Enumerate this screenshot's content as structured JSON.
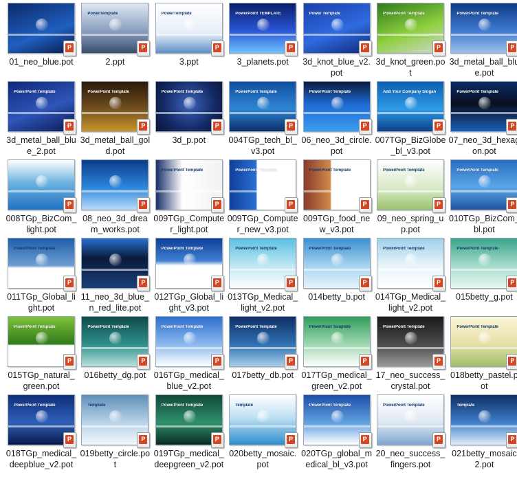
{
  "files": [
    {
      "name": "01_neo_blue.pot",
      "thumb": {
        "bg": "linear-gradient(160deg,#0b2a6b,#1f5fbf 60%,#0a1a4a)",
        "title": "",
        "dark": false
      }
    },
    {
      "name": "2.ppt",
      "thumb": {
        "bg": "linear-gradient(180deg,#dfe7f2,#8aa0bf 55%,#3c4f6d)",
        "title": "PowerTemplate",
        "dark": true
      }
    },
    {
      "name": "3.ppt",
      "thumb": {
        "bg": "linear-gradient(180deg,#ffffff,#e6eef7 60%,#5f8fc8)",
        "title": "PowerTemplate",
        "dark": true
      }
    },
    {
      "name": "3_planets.pot",
      "thumb": {
        "bg": "linear-gradient(180deg,#0a1d6a,#2a56d6 55%,#71c2ff)",
        "title": "PowerPoint TEMPLATE",
        "dark": false
      }
    },
    {
      "name": "3d_knot_blue_v2.pot",
      "thumb": {
        "bg": "linear-gradient(160deg,#1a3ea8,#2f6be0 55%,#0f2a7a)",
        "title": "Power Template",
        "dark": false
      }
    },
    {
      "name": "3d_knot_green.pot",
      "thumb": {
        "bg": "linear-gradient(160deg,#2f7a1c,#8ecf3e 55%,#cfd8cf)",
        "title": "PowerPoint Template",
        "dark": false
      }
    },
    {
      "name": "3d_metal_ball_blue.pot",
      "thumb": {
        "bg": "linear-gradient(180deg,#0f3b86,#3f7ad0 55%,#9dbfe8)",
        "title": "PowerPoint Template",
        "dark": false
      }
    },
    {
      "name": "3d_metal_ball_blue_2.pot",
      "thumb": {
        "bg": "linear-gradient(160deg,#10287a,#2e55b8 55%,#0b1b55)",
        "title": "PowerPoint Template",
        "dark": false
      }
    },
    {
      "name": "3d_metal_ball_gold.pot",
      "thumb": {
        "bg": "linear-gradient(180deg,#2b1a08,#6b4a1f 50%,#c8952a)",
        "title": "PowerPoint Template",
        "dark": false
      }
    },
    {
      "name": "3d_p.pot",
      "thumb": {
        "bg": "radial-gradient(circle at 50% 45%,#3b64b8,#142a66 60%,#0a1433)",
        "title": "PowerPoint Template",
        "dark": false
      }
    },
    {
      "name": "004TGp_tech_bl_v3.pot",
      "thumb": {
        "bg": "linear-gradient(180deg,#0f4fa0,#2e86d4 55%,#0b2d66)",
        "title": "PowerPoint Template",
        "dark": false
      }
    },
    {
      "name": "06_neo_3d_circle.pot",
      "thumb": {
        "bg": "linear-gradient(180deg,#0a1c3e,#1e6bd2 45%,#3a9cf0)",
        "title": "PowerPoint Template",
        "dark": false
      }
    },
    {
      "name": "007TGp_BizGlobe_bl_v3.pot",
      "thumb": {
        "bg": "linear-gradient(180deg,#0b5fb0,#2f9ae6 55%,#0a3f86)",
        "title": "Add Your Company Slogan",
        "dark": false
      }
    },
    {
      "name": "07_neo_3d_hexagon.pot",
      "thumb": {
        "bg": "linear-gradient(180deg,#0a2c66,#0a0f22 45%,#1b5fb8)",
        "title": "PowerPoint Template",
        "dark": false
      }
    },
    {
      "name": "008TGp_BizCom_light.pot",
      "thumb": {
        "bg": "linear-gradient(180deg,#ffffff,#6fb3e0 45%,#1f73c2)",
        "title": "",
        "dark": true
      }
    },
    {
      "name": "08_neo_3d_dream_works.pot",
      "thumb": {
        "bg": "linear-gradient(180deg,#0b3c8c,#2c86dc 55%,#b8dcf7)",
        "title": "",
        "dark": false
      }
    },
    {
      "name": "009TGp_Computer_light.pot",
      "thumb": {
        "bg": "linear-gradient(90deg,#1a2f6a,#ffffff 40%,#f2f2f2)",
        "title": "PowerPoint Template",
        "dark": true
      }
    },
    {
      "name": "009TGp_Computer_new_v3.pot",
      "thumb": {
        "bg": "linear-gradient(90deg,#0f3f9a,#2a6fd0 40%,#ffffff 42%)",
        "title": "PowerPoint Template",
        "dark": false
      }
    },
    {
      "name": "009TGp_food_new_v3.pot",
      "thumb": {
        "bg": "linear-gradient(90deg,#8a3a2a,#d08a4a 40%,#ffffff 42%)",
        "title": "PowerPoint Template",
        "dark": true
      }
    },
    {
      "name": "09_neo_spring_up.pot",
      "thumb": {
        "bg": "linear-gradient(180deg,#ffffff,#d7e8c4 60%,#9ac26a)",
        "title": "PowerPoint Template",
        "dark": true
      }
    },
    {
      "name": "010TGp_BizCom_bl.pot",
      "thumb": {
        "bg": "linear-gradient(180deg,#2a6fc2,#5aa5e8 55%,#1f55a0)",
        "title": "PowerPoint Template",
        "dark": false
      }
    },
    {
      "name": "011TGp_Global_light.pot",
      "thumb": {
        "bg": "linear-gradient(180deg,#1f5ea8,#6f9fd2 55%,#ffffff 60%)",
        "title": "PowerPoint Template",
        "dark": true
      }
    },
    {
      "name": "11_neo_3d_blue_n_red_lite.pot",
      "thumb": {
        "bg": "linear-gradient(180deg,#2a6fd0,#0a1a3a 40%,#1a3f7a)",
        "title": "",
        "dark": false
      }
    },
    {
      "name": "012TGp_Global_light_v3.pot",
      "thumb": {
        "bg": "linear-gradient(180deg,#0f3f9a,#3f7fd0 45%,#ffffff 55%)",
        "title": "PowerPoint Template",
        "dark": false
      }
    },
    {
      "name": "013TGp_Medical_light_v2.pot",
      "thumb": {
        "bg": "linear-gradient(180deg,#5bc0e0,#bfe7f3 55%,#ffffff)",
        "title": "PowerPoint Template",
        "dark": true
      }
    },
    {
      "name": "014betty_b.pot",
      "thumb": {
        "bg": "linear-gradient(180deg,#3b8fcf,#a6d3ef 55%,#e6f2fa)",
        "title": "PowerPoint Template",
        "dark": true
      }
    },
    {
      "name": "014TGp_Medical_light_v2.pot",
      "thumb": {
        "bg": "linear-gradient(180deg,#9fd0ea,#e8f4fa 55%,#ffffff)",
        "title": "PowerPoint Template",
        "dark": true
      }
    },
    {
      "name": "015betty_g.pot",
      "thumb": {
        "bg": "linear-gradient(180deg,#3aa48a,#a7dccd 55%,#e8f6f1)",
        "title": "PowerPoint Template",
        "dark": true
      }
    },
    {
      "name": "015TGp_natural_green.pot",
      "thumb": {
        "bg": "linear-gradient(180deg,#7fc23a,#2f7a1c 55%,#ffffff 58%)",
        "title": "PowerPoint Template",
        "dark": false
      }
    },
    {
      "name": "016betty_dg.pot",
      "thumb": {
        "bg": "linear-gradient(180deg,#0f4a4a,#2f8f8a 55%,#b8e0dc)",
        "title": "PowerPoint Template",
        "dark": false
      }
    },
    {
      "name": "016TGp_medical_blue_v2.pot",
      "thumb": {
        "bg": "linear-gradient(180deg,#2f6fd0,#8ab8ee 55%,#ffffff)",
        "title": "PowerPoint Template",
        "dark": false
      }
    },
    {
      "name": "017betty_db.pot",
      "thumb": {
        "bg": "linear-gradient(180deg,#0f2f66,#2f6fb0 55%,#a6cfe8)",
        "title": "PowerPoint Template",
        "dark": false
      }
    },
    {
      "name": "017TGp_medical_green_v2.pot",
      "thumb": {
        "bg": "linear-gradient(180deg,#2f9f5a,#9fd6b0 55%,#ffffff)",
        "title": "PowerPoint Template",
        "dark": true
      }
    },
    {
      "name": "17_neo_success_crystal.pot",
      "thumb": {
        "bg": "linear-gradient(180deg,#1a1a1a,#4a4a4a 55%,#9a9a9a)",
        "title": "PowerPoint Template",
        "dark": false
      }
    },
    {
      "name": "018betty_pastel.pot",
      "thumb": {
        "bg": "linear-gradient(180deg,#fbf6d6,#e6e0a8 55%,#9fbf6a)",
        "title": "PowerPoint Template",
        "dark": true
      }
    },
    {
      "name": "018TGp_medical_deepblue_v2.pot",
      "thumb": {
        "bg": "linear-gradient(180deg,#0f2f7a,#2f5fb8 55%,#0a1a4a)",
        "title": "PowerPoint Template",
        "dark": false
      }
    },
    {
      "name": "019betty_circle.pot",
      "thumb": {
        "bg": "linear-gradient(180deg,#5f8fb8,#b8d3e8 55%,#f2f7fb)",
        "title": "Template",
        "dark": true
      }
    },
    {
      "name": "019TGp_medical_deepgreen_v2.pot",
      "thumb": {
        "bg": "linear-gradient(180deg,#0f4a3a,#2f8f6a 55%,#0a2a22)",
        "title": "PowerPoint Template",
        "dark": false
      }
    },
    {
      "name": "020betty_mosaic.pot",
      "thumb": {
        "bg": "linear-gradient(180deg,#ffffff,#bfe0f2 45%,#2f8fcf)",
        "title": "Template",
        "dark": true
      }
    },
    {
      "name": "020TGp_global_medical_bl_v3.pot",
      "thumb": {
        "bg": "linear-gradient(180deg,#1f4fa8,#5f9fe0 55%,#ffffff)",
        "title": "PowerPoint Template",
        "dark": false
      }
    },
    {
      "name": "20_neo_success_fingers.pot",
      "thumb": {
        "bg": "linear-gradient(180deg,#ffffff,#dfe8f2 55%,#7fa6d0)",
        "title": "PowerPoint Template",
        "dark": true
      }
    },
    {
      "name": "021betty_mosaic2.pot",
      "thumb": {
        "bg": "linear-gradient(180deg,#0f2f66,#3f7fc8 55%,#dfeef8)",
        "title": "Template",
        "dark": false
      }
    }
  ],
  "badge_text": "P"
}
